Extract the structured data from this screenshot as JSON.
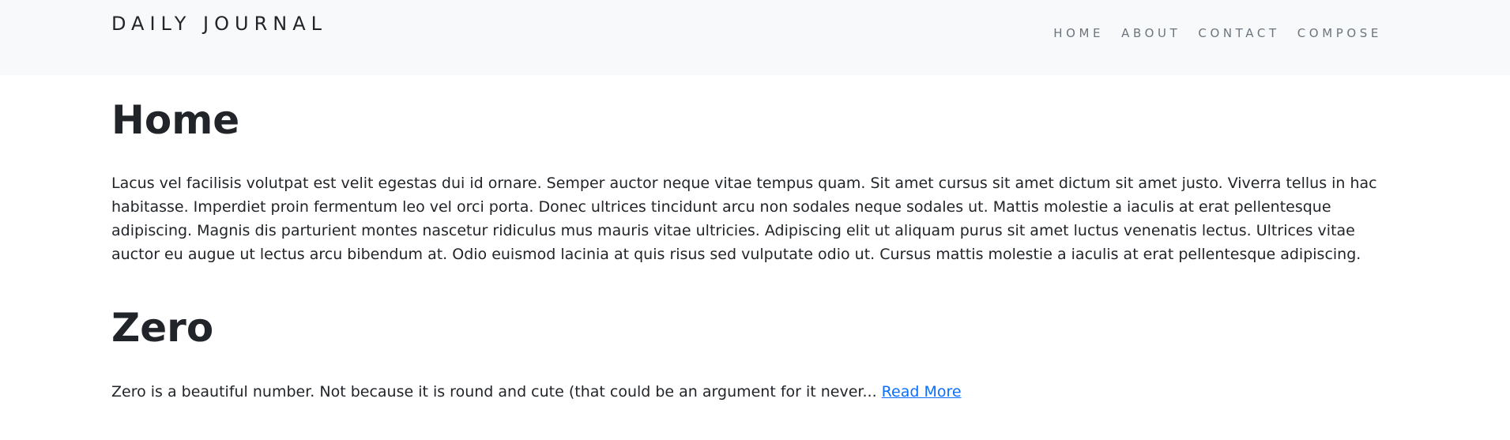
{
  "header": {
    "brand": "DAILY JOURNAL",
    "nav": [
      "HOME",
      "ABOUT",
      "CONTACT",
      "COMPOSE"
    ]
  },
  "home": {
    "title": "Home",
    "body": "Lacus vel facilisis volutpat est velit egestas dui id ornare. Semper auctor neque vitae tempus quam. Sit amet cursus sit amet dictum sit amet justo. Viverra tellus in hac habitasse. Imperdiet proin fermentum leo vel orci porta. Donec ultrices tincidunt arcu non sodales neque sodales ut. Mattis molestie a iaculis at erat pellentesque adipiscing. Magnis dis parturient montes nascetur ridiculus mus mauris vitae ultricies. Adipiscing elit ut aliquam purus sit amet luctus venenatis lectus. Ultrices vitae auctor eu augue ut lectus arcu bibendum at. Odio euismod lacinia at quis risus sed vulputate odio ut. Cursus mattis molestie a iaculis at erat pellentesque adipiscing."
  },
  "posts": [
    {
      "title": "Zero",
      "excerpt": "Zero is a beautiful number. Not because it is round and cute (that could be an argument for it never...",
      "read_more": "Read More"
    }
  ],
  "colors": {
    "navbar_bg": "#f8f9fa",
    "link": "#0d6efd",
    "nav_text": "#6c757d",
    "text": "#212529"
  }
}
